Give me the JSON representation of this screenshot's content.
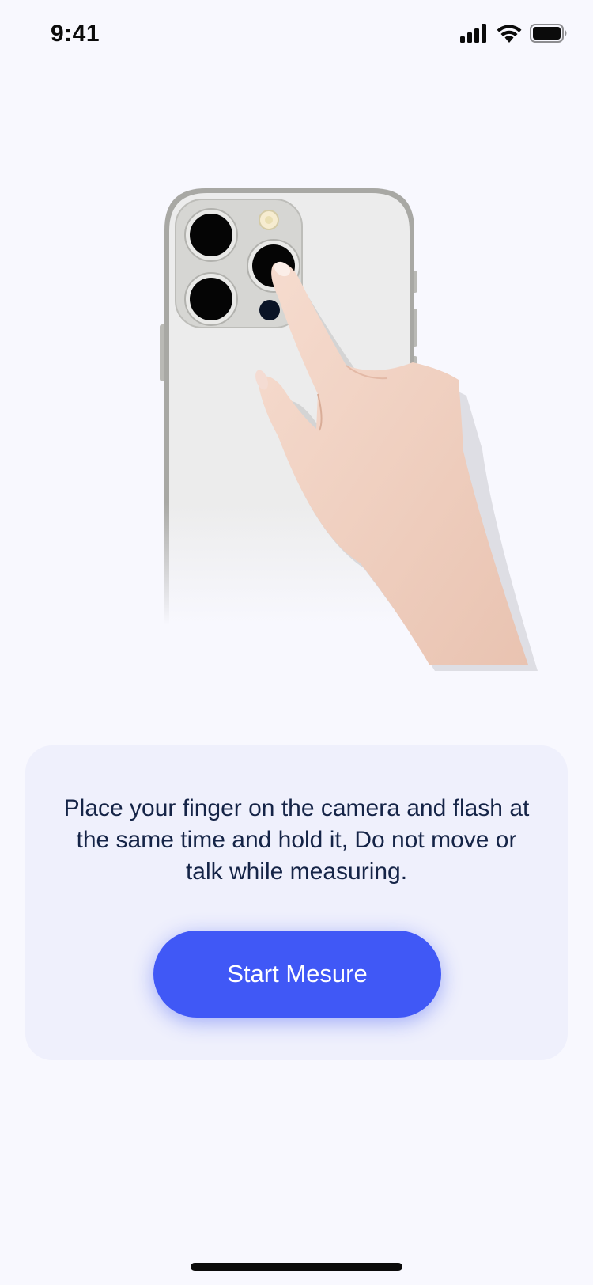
{
  "status_bar": {
    "time": "9:41"
  },
  "icons": {
    "signal": "cellular-signal-icon",
    "wifi": "wifi-icon",
    "battery": "battery-icon"
  },
  "instruction": {
    "text": "Place your finger on the camera and flash at the same time and hold it, Do not move or talk while measuring."
  },
  "actions": {
    "start_label": "Start Mesure"
  },
  "colors": {
    "background": "#f8f8fe",
    "card": "#eff0fc",
    "text": "#152447",
    "accent": "#4058f6"
  }
}
